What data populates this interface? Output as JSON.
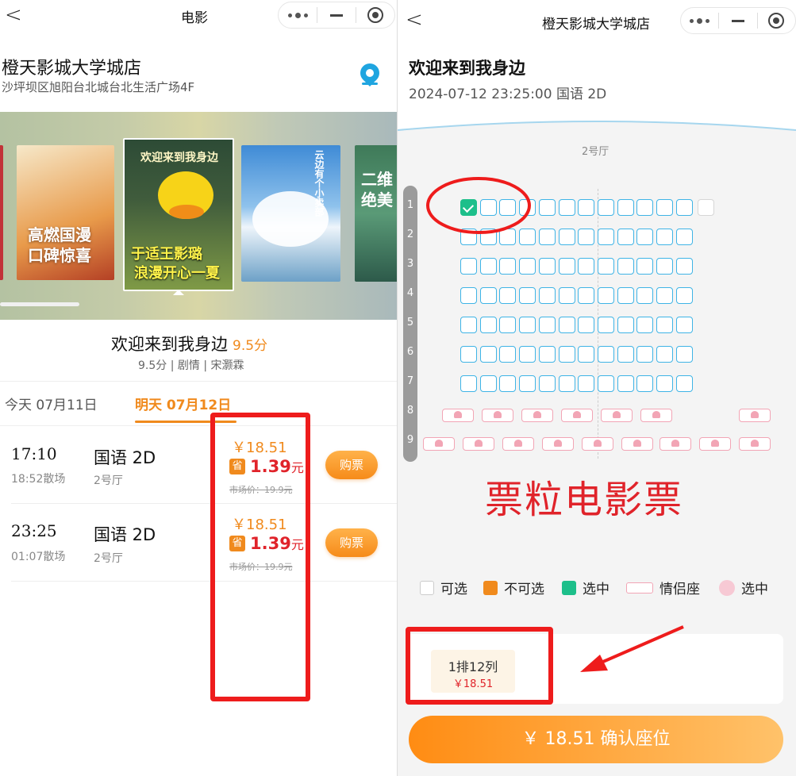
{
  "left": {
    "nav": {
      "back": "<",
      "title": "电影"
    },
    "cinema": {
      "name": "橙天影城大学城店",
      "address": "沙坪坝区旭阳台北城台北生活广场4F"
    },
    "posters": [
      {
        "text": "高燃国漫\n口碑惊喜"
      },
      {
        "top_text": "欢迎来到我身边",
        "line1": "于适王影璐",
        "line2": "浪漫开心一夏"
      },
      {
        "text": "云边有个小卖部"
      },
      {
        "text": "二维\n绝美"
      }
    ],
    "movie": {
      "title": "欢迎来到我身边",
      "score": "9.5分",
      "meta": "9.5分 | 剧情 | 宋灏霖"
    },
    "tabs": [
      {
        "label": "今天 07月11日"
      },
      {
        "label": "明天 07月12日"
      }
    ],
    "showtimes": [
      {
        "time": "17:10",
        "end": "18:52散场",
        "lang": "国语 2D",
        "hall": "2号厅",
        "price": "￥18.51",
        "save_icon": "省",
        "save_price": "1.39",
        "unit": "元",
        "market": "市场价：19.9元",
        "buy": "购票"
      },
      {
        "time": "23:25",
        "end": "01:07散场",
        "lang": "国语 2D",
        "hall": "2号厅",
        "price": "￥18.51",
        "save_icon": "省",
        "save_price": "1.39",
        "unit": "元",
        "market": "市场价：19.9元",
        "buy": "购票"
      }
    ]
  },
  "right": {
    "nav": {
      "back": "<",
      "title": "橙天影城大学城店"
    },
    "movie_title": "欢迎来到我身边",
    "session": "2024-07-12 23:25:00 国语 2D",
    "hall": "2号厅",
    "row_numbers": [
      "1",
      "2",
      "3",
      "4",
      "5",
      "6",
      "7",
      "8",
      "9"
    ],
    "watermark": "票粒电影票",
    "legend": [
      {
        "label": "可选",
        "kind": "available"
      },
      {
        "label": "不可选",
        "kind": "unavailable"
      },
      {
        "label": "选中",
        "kind": "selected"
      },
      {
        "label": "情侣座",
        "kind": "love"
      },
      {
        "label": "选中",
        "kind": "love-selected"
      }
    ],
    "selected_seat": {
      "seat": "1排12列",
      "price": "￥18.51"
    },
    "confirm_label": "￥ 18.51 确认座位"
  },
  "colors": {
    "accent": "#f08a1d",
    "price_red": "#e0232a",
    "seat_blue": "#3fb4e6",
    "selected_green": "#1dbf8a",
    "love_pink": "#f2a5b5",
    "annotation_red": "#ee1c1c"
  }
}
